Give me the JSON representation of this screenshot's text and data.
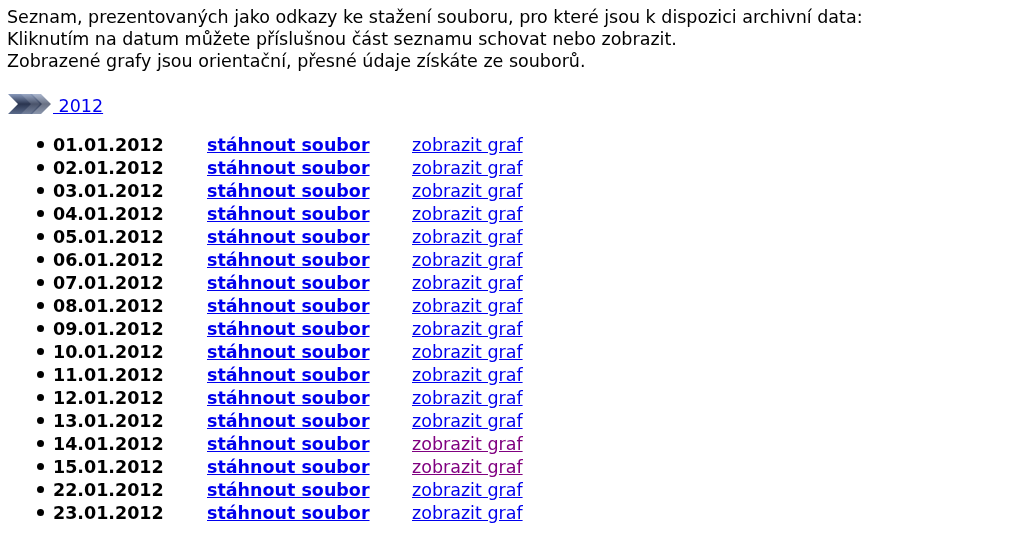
{
  "intro": [
    "Seznam, prezentovaných jako odkazy ke stažení souboru, pro které jsou k dispozici archivní data:",
    "Kliknutím na datum můžete příslušnou část seznamu schovat nebo zobrazit.",
    "Zobrazené grafy jsou orientační, přesné údaje získáte ze souborů."
  ],
  "year": {
    "label": " 2012",
    "expanded": true
  },
  "rows": [
    {
      "date": "01.01.2012",
      "download": "stáhnout soubor",
      "chart": "zobrazit graf",
      "visited": false
    },
    {
      "date": "02.01.2012",
      "download": "stáhnout soubor",
      "chart": "zobrazit graf",
      "visited": false
    },
    {
      "date": "03.01.2012",
      "download": "stáhnout soubor",
      "chart": "zobrazit graf",
      "visited": false
    },
    {
      "date": "04.01.2012",
      "download": "stáhnout soubor",
      "chart": "zobrazit graf",
      "visited": false
    },
    {
      "date": "05.01.2012",
      "download": "stáhnout soubor",
      "chart": "zobrazit graf",
      "visited": false
    },
    {
      "date": "06.01.2012",
      "download": "stáhnout soubor",
      "chart": "zobrazit graf",
      "visited": false
    },
    {
      "date": "07.01.2012",
      "download": "stáhnout soubor",
      "chart": "zobrazit graf",
      "visited": false
    },
    {
      "date": "08.01.2012",
      "download": "stáhnout soubor",
      "chart": "zobrazit graf",
      "visited": false
    },
    {
      "date": "09.01.2012",
      "download": "stáhnout soubor",
      "chart": "zobrazit graf",
      "visited": false
    },
    {
      "date": "10.01.2012",
      "download": "stáhnout soubor",
      "chart": "zobrazit graf",
      "visited": false
    },
    {
      "date": "11.01.2012",
      "download": "stáhnout soubor",
      "chart": "zobrazit graf",
      "visited": false
    },
    {
      "date": "12.01.2012",
      "download": "stáhnout soubor",
      "chart": "zobrazit graf",
      "visited": false
    },
    {
      "date": "13.01.2012",
      "download": "stáhnout soubor",
      "chart": "zobrazit graf",
      "visited": false
    },
    {
      "date": "14.01.2012",
      "download": "stáhnout soubor",
      "chart": "zobrazit graf",
      "visited": true
    },
    {
      "date": "15.01.2012",
      "download": "stáhnout soubor",
      "chart": "zobrazit graf",
      "visited": true
    },
    {
      "date": "22.01.2012",
      "download": "stáhnout soubor",
      "chart": "zobrazit graf",
      "visited": false
    },
    {
      "date": "23.01.2012",
      "download": "stáhnout soubor",
      "chart": "zobrazit graf",
      "visited": false
    }
  ]
}
